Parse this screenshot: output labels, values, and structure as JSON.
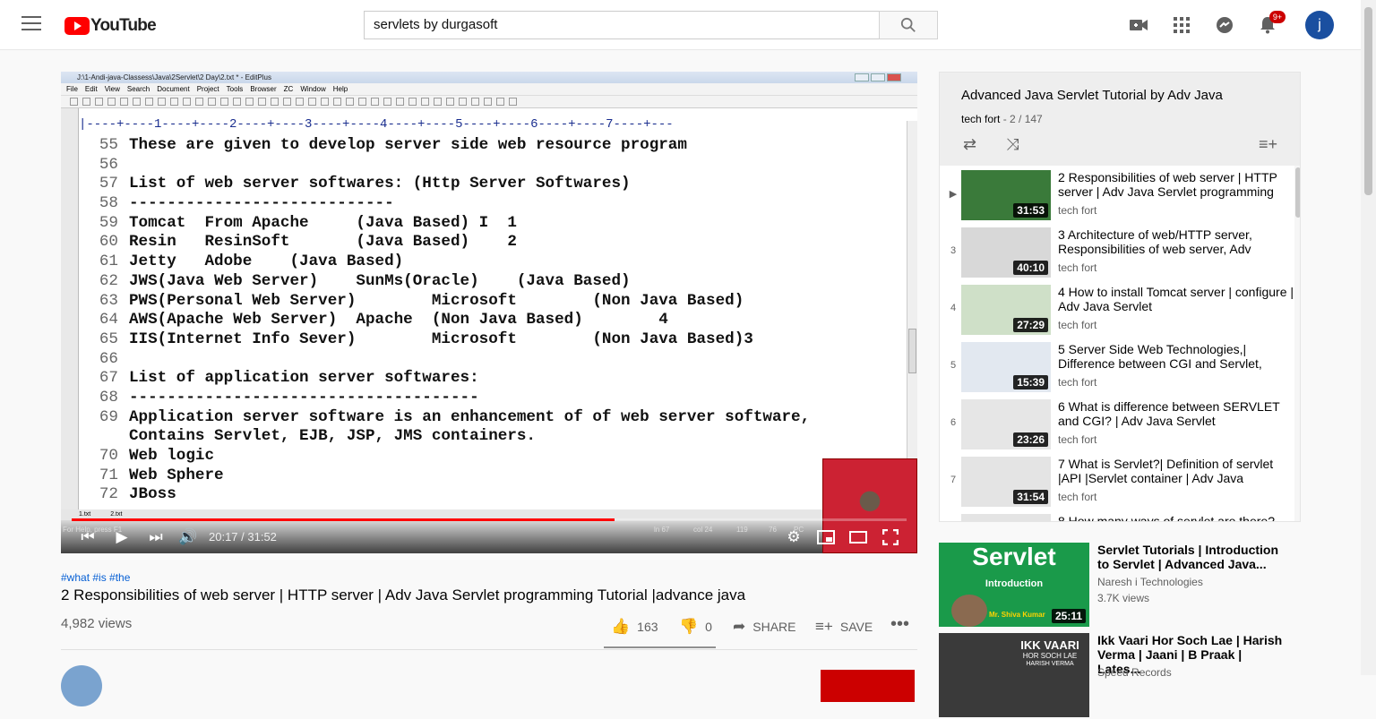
{
  "header": {
    "logo_text": "YouTube",
    "search_value": "servlets by durgasoft",
    "notification_count": "9+",
    "avatar_letter": "j"
  },
  "player": {
    "editor_title": "J:\\1-Andi-java-Classess\\Java\\2Servlet\\2 Day\\2.txt * - EditPlus",
    "menu": [
      "File",
      "Edit",
      "View",
      "Search",
      "Document",
      "Project",
      "Tools",
      "Browser",
      "ZC",
      "Window",
      "Help"
    ],
    "ruler": "|----+----1----+----2----+----3----+----4----+----5----+----6----+----7----+---",
    "code_lines": [
      {
        "num": "55",
        "text": "These are given to develop server side web resource program"
      },
      {
        "num": "56",
        "text": ""
      },
      {
        "num": "57",
        "text": "List of web server softwares: (Http Server Softwares)"
      },
      {
        "num": "58",
        "text": "----------------------------"
      },
      {
        "num": "59",
        "text": "Tomcat  From Apache     (Java Based) I  1"
      },
      {
        "num": "60",
        "text": "Resin   ResinSoft       (Java Based)    2"
      },
      {
        "num": "61",
        "text": "Jetty   Adobe    (Java Based)"
      },
      {
        "num": "62",
        "text": "JWS(Java Web Server)    SunMs(Oracle)    (Java Based)"
      },
      {
        "num": "63",
        "text": "PWS(Personal Web Server)        Microsoft        (Non Java Based)"
      },
      {
        "num": "64",
        "text": "AWS(Apache Web Server)  Apache  (Non Java Based)        4"
      },
      {
        "num": "65",
        "text": "IIS(Internet Info Sever)        Microsoft        (Non Java Based)3"
      },
      {
        "num": "66",
        "text": ""
      },
      {
        "num": "67",
        "text": "List of application server softwares:"
      },
      {
        "num": "68",
        "text": "-------------------------------------"
      },
      {
        "num": "69",
        "text": "Application server software is an enhancement of of web server software,"
      },
      {
        "num": "",
        "text": "Contains Servlet, EJB, JSP, JMS containers."
      },
      {
        "num": "70",
        "text": "Web logic"
      },
      {
        "num": "71",
        "text": "Web Sphere"
      },
      {
        "num": "72",
        "text": "JBoss"
      }
    ],
    "tabs": [
      "1.txt",
      "2.txt"
    ],
    "status_help": "For Help, press F1",
    "status_ln": "ln 67",
    "status_col": "col 24",
    "status_a": "119",
    "status_b": "76",
    "status_c": "PC",
    "time": "20:17 / 31:52",
    "progress": 0.65
  },
  "video": {
    "hashtags": "#what #is #the",
    "title": "2 Responsibilities of web server | HTTP server | Adv Java Servlet programming Tutorial |advance java",
    "views": "4,982 views",
    "likes": "163",
    "dislikes": "0",
    "share": "SHARE",
    "save": "SAVE"
  },
  "playlist": {
    "title": "Advanced Java Servlet Tutorial by Adv Java",
    "channel": "tech fort",
    "position": " - 2 / 147",
    "items": [
      {
        "index": "▶",
        "title": "2 Responsibilities of web server | HTTP server | Adv Java Servlet programming",
        "channel": "tech fort",
        "duration": "31:53"
      },
      {
        "index": "3",
        "title": "3 Architecture of web/HTTP server, Responsibilities of web server, Adv",
        "channel": "tech fort",
        "duration": "40:10"
      },
      {
        "index": "4",
        "title": "4 How to install Tomcat server | configure | Adv Java Servlet",
        "channel": "tech fort",
        "duration": "27:29"
      },
      {
        "index": "5",
        "title": "5 Server Side Web Technologies,| Difference between CGI and Servlet,",
        "channel": "tech fort",
        "duration": "15:39"
      },
      {
        "index": "6",
        "title": "6 What is difference between SERVLET and CGI? | Adv Java Servlet",
        "channel": "tech fort",
        "duration": "23:26"
      },
      {
        "index": "7",
        "title": "7 What is Servlet?| Definition of servlet |API |Servlet container | Adv Java",
        "channel": "tech fort",
        "duration": "31:54"
      },
      {
        "index": "",
        "title": "8 How many ways of servlet are there?",
        "channel": "",
        "duration": ""
      }
    ]
  },
  "recommended": [
    {
      "title": "Servlet Tutorials | Introduction to Servlet | Advanced Java...",
      "channel": "Naresh i Technologies",
      "views": "3.7K views",
      "duration": "25:11",
      "thumb_title": "Servlet",
      "thumb_sub": "Introduction",
      "thumb_name": "Mr. Shiva Kumar"
    },
    {
      "title": "Ikk Vaari Hor Soch Lae | Harish Verma | Jaani | B Praak | Lates...",
      "channel": "Speed Records",
      "views": "",
      "duration": "",
      "thumb_title": "IKK VAARI",
      "thumb_sub": "HOR SOCH LAE",
      "thumb_name": "HARISH VERMA"
    }
  ]
}
